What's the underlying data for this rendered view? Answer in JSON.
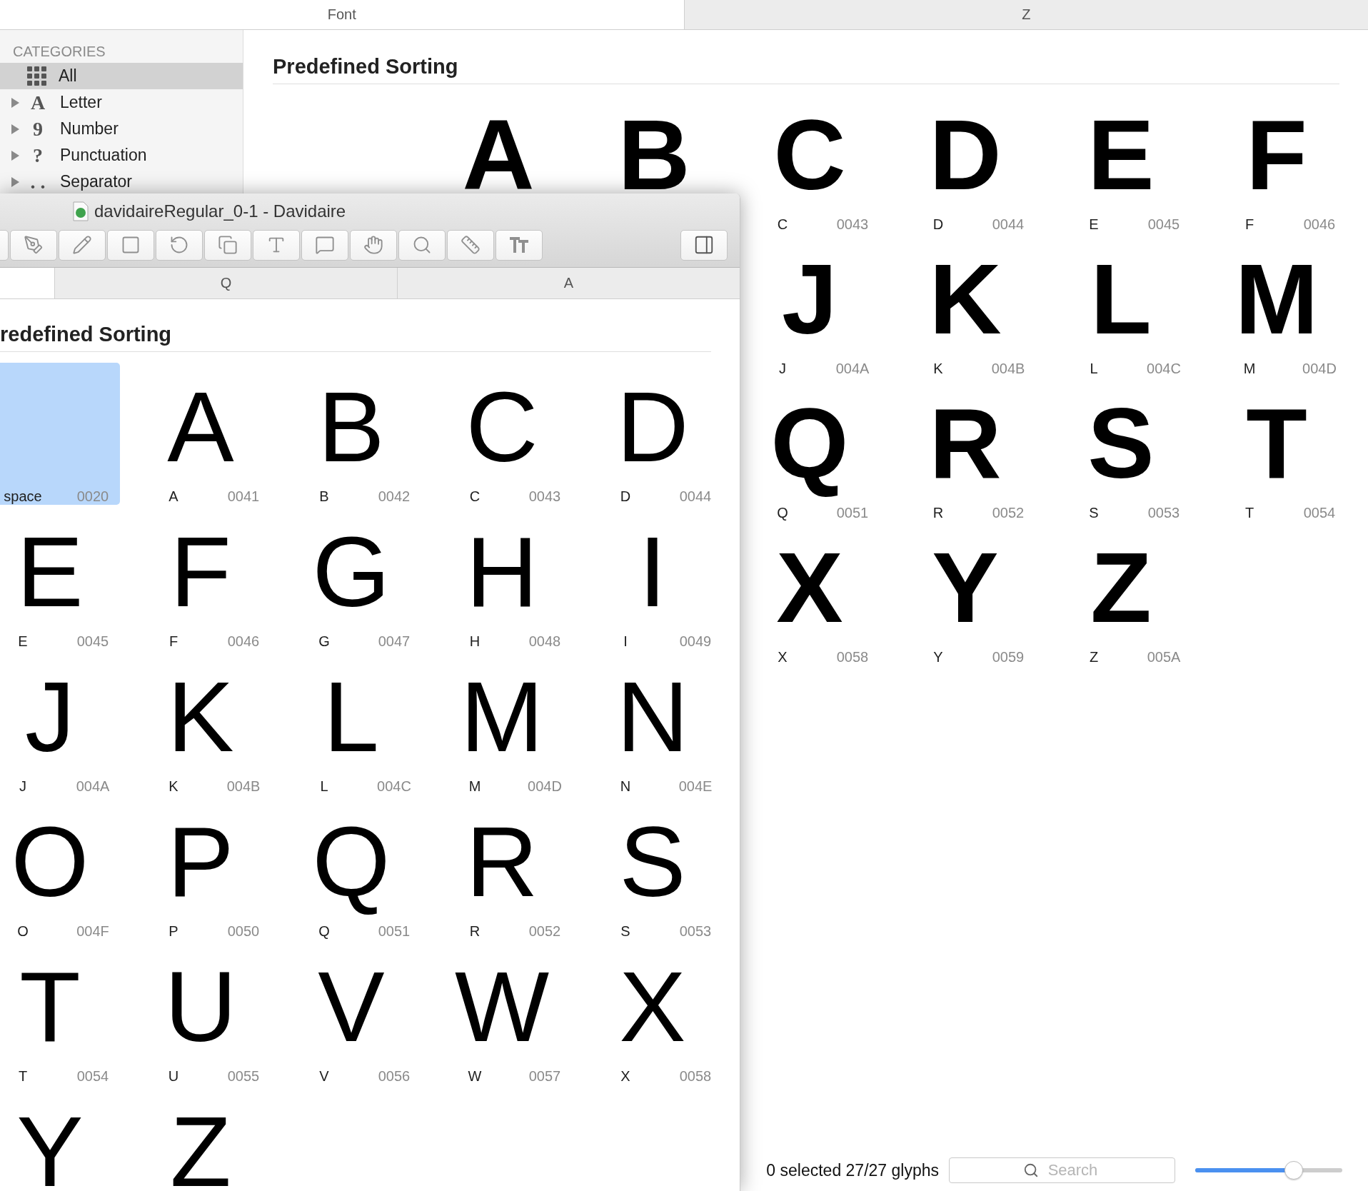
{
  "back_window": {
    "tabs": [
      {
        "label": "Font",
        "selected": true
      },
      {
        "label": "Z",
        "selected": false
      }
    ],
    "sidebar": {
      "header": "CATEGORIES",
      "items": [
        {
          "kind": "all",
          "label": "All",
          "selected": true
        },
        {
          "kind": "category",
          "glyph": "A",
          "label": "Letter",
          "selected": false,
          "expanded": false
        },
        {
          "kind": "category",
          "glyph": "9",
          "label": "Number",
          "selected": false,
          "expanded": false
        },
        {
          "kind": "category",
          "glyph": "?",
          "label": "Punctuation",
          "selected": false,
          "expanded": false
        },
        {
          "kind": "category",
          "glyph": ". .",
          "label": "Separator",
          "selected": false,
          "expanded": false
        }
      ]
    },
    "heading": "Predefined Sorting",
    "glyph_rows": [
      [
        {
          "kind": "covered"
        },
        {
          "kind": "glyph",
          "glyph": "A",
          "selected": false
        },
        {
          "kind": "glyph",
          "glyph": "B",
          "selected": false
        },
        {
          "kind": "cell",
          "glyph": "C",
          "name": "C",
          "code": "0043",
          "selected": false
        },
        {
          "kind": "cell",
          "glyph": "D",
          "name": "D",
          "code": "0044",
          "selected": false
        },
        {
          "kind": "cell",
          "glyph": "E",
          "name": "E",
          "code": "0045",
          "selected": false
        },
        {
          "kind": "cell",
          "glyph": "F",
          "name": "F",
          "code": "0046",
          "selected": false
        }
      ],
      [
        {
          "kind": "covered"
        },
        {
          "kind": "covered"
        },
        {
          "kind": "covered"
        },
        {
          "kind": "cell",
          "glyph": "J",
          "name": "J",
          "code": "004A",
          "selected": false
        },
        {
          "kind": "cell",
          "glyph": "K",
          "name": "K",
          "code": "004B",
          "selected": false
        },
        {
          "kind": "cell",
          "glyph": "L",
          "name": "L",
          "code": "004C",
          "selected": false
        },
        {
          "kind": "cell",
          "glyph": "M",
          "name": "M",
          "code": "004D",
          "selected": false
        }
      ],
      [
        {
          "kind": "covered"
        },
        {
          "kind": "covered"
        },
        {
          "kind": "covered"
        },
        {
          "kind": "cell",
          "glyph": "Q",
          "name": "Q",
          "code": "0051",
          "selected": false
        },
        {
          "kind": "cell",
          "glyph": "R",
          "name": "R",
          "code": "0052",
          "selected": false
        },
        {
          "kind": "cell",
          "glyph": "S",
          "name": "S",
          "code": "0053",
          "selected": false
        },
        {
          "kind": "cell",
          "glyph": "T",
          "name": "T",
          "code": "0054",
          "selected": false
        }
      ],
      [
        {
          "kind": "covered"
        },
        {
          "kind": "covered"
        },
        {
          "kind": "covered"
        },
        {
          "kind": "cell",
          "glyph": "X",
          "name": "X",
          "code": "0058",
          "selected": false
        },
        {
          "kind": "cell",
          "glyph": "Y",
          "name": "Y",
          "code": "0059",
          "selected": false
        },
        {
          "kind": "cell",
          "glyph": "Z",
          "name": "Z",
          "code": "005A",
          "selected": false
        }
      ]
    ],
    "status_bar": {
      "summary": "0 selected 27/27 glyphs",
      "search": {
        "placeholder": "Search"
      },
      "zoom_slider": {
        "level": 0.67
      }
    }
  },
  "front_window": {
    "title": "davidaireRegular_0-1 - Davidaire",
    "tabs": [
      {
        "selected": true
      },
      {
        "label": "Q",
        "selected": false
      },
      {
        "label": "A",
        "selected": false
      }
    ],
    "heading": "redefined Sorting",
    "glyph_rows": [
      [
        {
          "kind": "cell",
          "name": "space",
          "code": "0020",
          "selected": true
        },
        {
          "kind": "cell",
          "glyph": "A",
          "name": "A",
          "code": "0041",
          "selected": false
        },
        {
          "kind": "cell",
          "glyph": "B",
          "name": "B",
          "code": "0042",
          "selected": false
        },
        {
          "kind": "cell",
          "glyph": "C",
          "name": "C",
          "code": "0043",
          "selected": false
        },
        {
          "kind": "cell",
          "glyph": "D",
          "name": "D",
          "code": "0044",
          "selected": false
        }
      ],
      [
        {
          "kind": "cell",
          "glyph": "E",
          "name": "E",
          "code": "0045",
          "selected": false
        },
        {
          "kind": "cell",
          "glyph": "F",
          "name": "F",
          "code": "0046",
          "selected": false
        },
        {
          "kind": "cell",
          "glyph": "G",
          "name": "G",
          "code": "0047",
          "selected": false
        },
        {
          "kind": "cell",
          "glyph": "H",
          "name": "H",
          "code": "0048",
          "selected": false
        },
        {
          "kind": "cell",
          "glyph": "I",
          "name": "I",
          "code": "0049",
          "selected": false
        }
      ],
      [
        {
          "kind": "cell",
          "glyph": "J",
          "name": "J",
          "code": "004A",
          "selected": false
        },
        {
          "kind": "cell",
          "glyph": "K",
          "name": "K",
          "code": "004B",
          "selected": false
        },
        {
          "kind": "cell",
          "glyph": "L",
          "name": "L",
          "code": "004C",
          "selected": false
        },
        {
          "kind": "cell",
          "glyph": "M",
          "name": "M",
          "code": "004D",
          "selected": false
        },
        {
          "kind": "cell",
          "glyph": "N",
          "name": "N",
          "code": "004E",
          "selected": false
        }
      ],
      [
        {
          "kind": "cell",
          "glyph": "O",
          "name": "O",
          "code": "004F",
          "selected": false
        },
        {
          "kind": "cell",
          "glyph": "P",
          "name": "P",
          "code": "0050",
          "selected": false
        },
        {
          "kind": "cell",
          "glyph": "Q",
          "name": "Q",
          "code": "0051",
          "selected": false
        },
        {
          "kind": "cell",
          "glyph": "R",
          "name": "R",
          "code": "0052",
          "selected": false
        },
        {
          "kind": "cell",
          "glyph": "S",
          "name": "S",
          "code": "0053",
          "selected": false
        }
      ],
      [
        {
          "kind": "cell",
          "glyph": "T",
          "name": "T",
          "code": "0054",
          "selected": false
        },
        {
          "kind": "cell",
          "glyph": "U",
          "name": "U",
          "code": "0055",
          "selected": false
        },
        {
          "kind": "cell",
          "glyph": "V",
          "name": "V",
          "code": "0056",
          "selected": false
        },
        {
          "kind": "cell",
          "glyph": "W",
          "name": "W",
          "code": "0057",
          "selected": false
        },
        {
          "kind": "cell",
          "glyph": "X",
          "name": "X",
          "code": "0058",
          "selected": false
        }
      ],
      [
        {
          "kind": "glyph",
          "glyph": "Y",
          "selected": false
        },
        {
          "kind": "glyph",
          "glyph": "Z",
          "selected": false
        }
      ]
    ]
  }
}
